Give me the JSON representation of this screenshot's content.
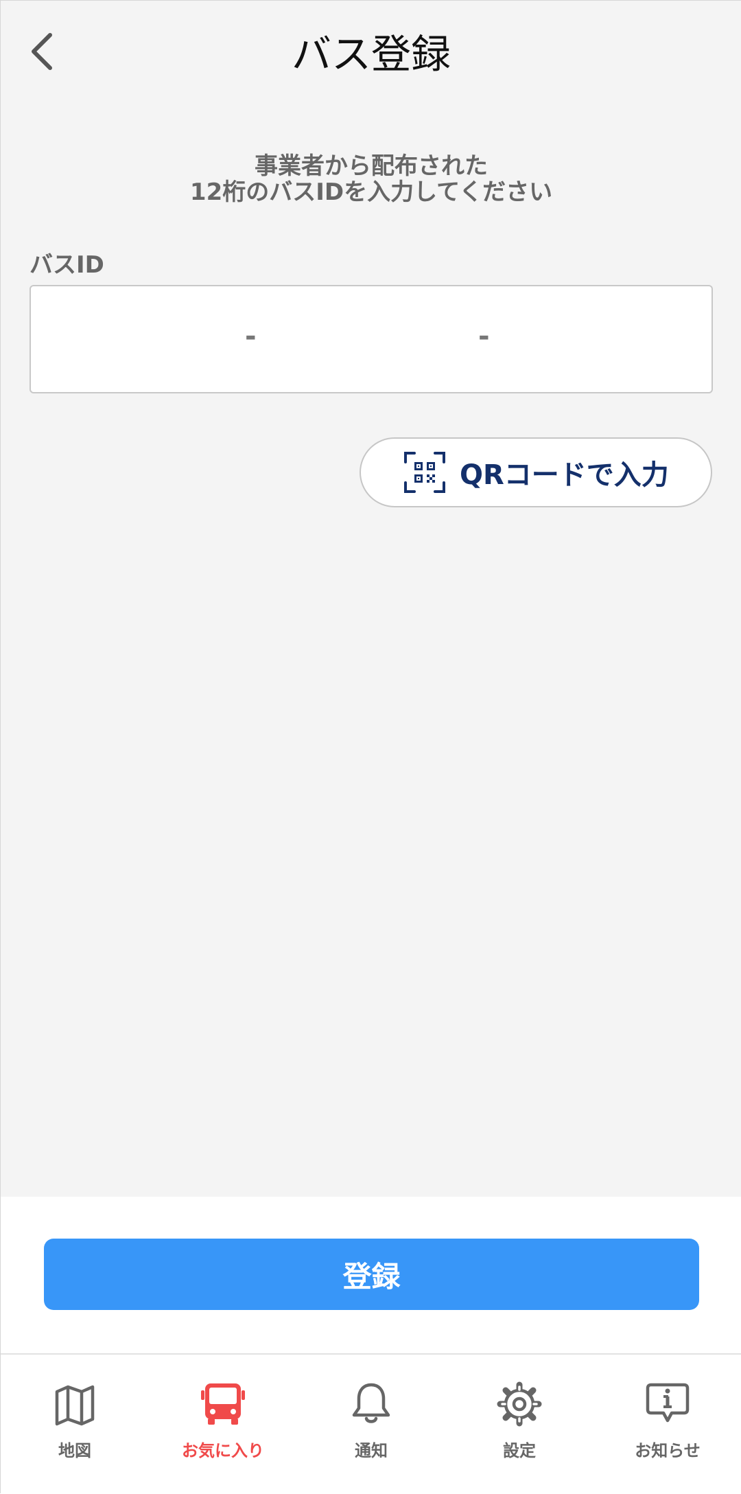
{
  "header": {
    "title": "バス登録"
  },
  "instruction": {
    "line1": "事業者から配布された",
    "line2": "12桁のバスIDを入力してください"
  },
  "bus_id_field": {
    "label": "バスID",
    "separator": "-",
    "value": ""
  },
  "qr_button": {
    "label": "QRコードで入力",
    "icon": "qr-scan-icon"
  },
  "register_button": {
    "label": "登録"
  },
  "tab_bar": {
    "active_index": 1,
    "tabs": [
      {
        "label": "地図",
        "icon": "map-icon"
      },
      {
        "label": "お気に入り",
        "icon": "bus-icon"
      },
      {
        "label": "通知",
        "icon": "bell-icon"
      },
      {
        "label": "設定",
        "icon": "gear-icon"
      },
      {
        "label": "お知らせ",
        "icon": "info-message-icon"
      }
    ]
  },
  "colors": {
    "accent_blue": "#3896f8",
    "active_red": "#f04a4a",
    "qr_text_navy": "#14306b",
    "background_gray": "#f4f4f4"
  }
}
